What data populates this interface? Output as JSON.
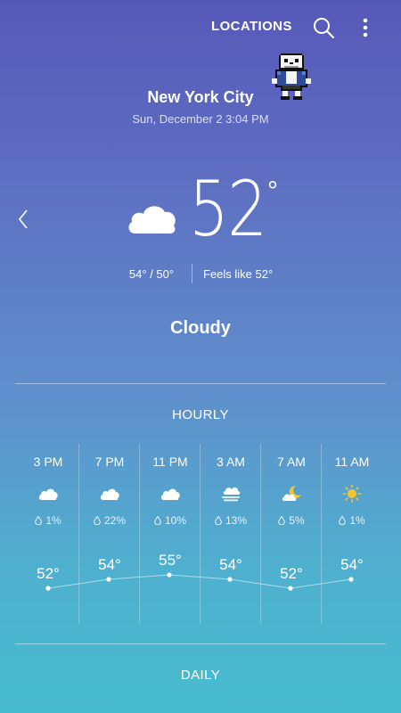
{
  "header": {
    "locations_label": "LOCATIONS",
    "search_icon": "search-icon",
    "more_icon": "more-vert-icon"
  },
  "current": {
    "city": "New York City",
    "datetime": "Sun, December 2 3:04 PM",
    "temperature": "52",
    "degree": "°",
    "hi_lo": "54°  /  50°",
    "feels_like": "Feels like 52°",
    "condition": "Cloudy",
    "icon": "cloud-icon"
  },
  "hourly": {
    "title": "HOURLY",
    "items": [
      {
        "time": "3 PM",
        "icon": "cloud-icon",
        "precip": "1%",
        "temp": "52°",
        "value": 52
      },
      {
        "time": "7 PM",
        "icon": "cloud-icon",
        "precip": "22%",
        "temp": "54°",
        "value": 54
      },
      {
        "time": "11 PM",
        "icon": "cloud-icon",
        "precip": "10%",
        "temp": "55°",
        "value": 55
      },
      {
        "time": "3 AM",
        "icon": "fog-icon",
        "precip": "13%",
        "temp": "54°",
        "value": 54
      },
      {
        "time": "7 AM",
        "icon": "cloud-moon-icon",
        "precip": "5%",
        "temp": "52°",
        "value": 52
      },
      {
        "time": "11 AM",
        "icon": "sun-icon",
        "precip": "1%",
        "temp": "54°",
        "value": 54
      }
    ]
  },
  "daily": {
    "title": "DAILY"
  },
  "colors": {
    "gradient_top": "#5658b8",
    "gradient_bottom": "#47bccf",
    "sun": "#f6c532"
  }
}
